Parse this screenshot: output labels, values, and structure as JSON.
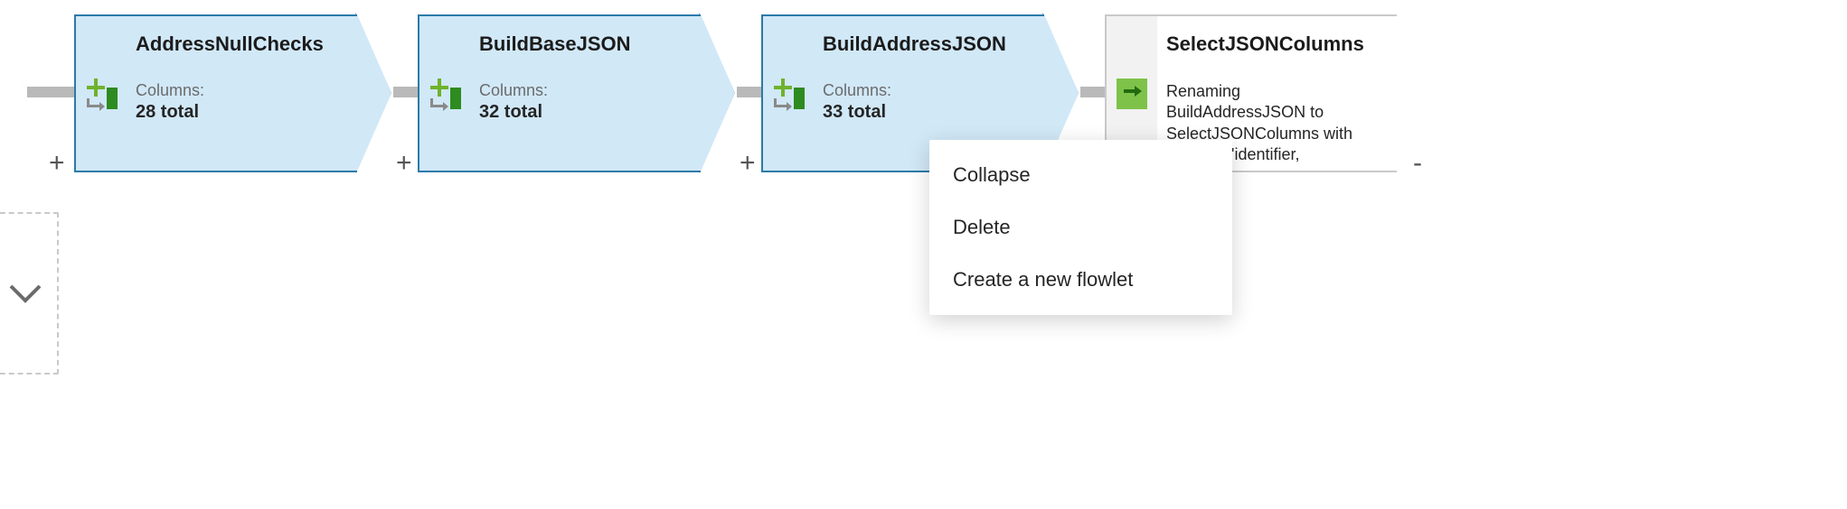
{
  "nodes": [
    {
      "id": "AddressNullChecks",
      "title": "AddressNullChecks",
      "columns_label": "Columns:",
      "columns_value": "28 total",
      "type": "derived-column"
    },
    {
      "id": "BuildBaseJSON",
      "title": "BuildBaseJSON",
      "columns_label": "Columns:",
      "columns_value": "32 total",
      "type": "derived-column"
    },
    {
      "id": "BuildAddressJSON",
      "title": "BuildAddressJSON",
      "columns_label": "Columns:",
      "columns_value": "33 total",
      "type": "derived-column"
    },
    {
      "id": "SelectJSONColumns",
      "title": "SelectJSONColumns",
      "description": "Renaming BuildAddressJSON to SelectJSONColumns with columns 'identifier, address,",
      "type": "select"
    }
  ],
  "add_button_label": "+",
  "context_menu": {
    "items": [
      {
        "label": "Collapse"
      },
      {
        "label": "Delete"
      },
      {
        "label": "Create a new flowlet"
      }
    ]
  }
}
